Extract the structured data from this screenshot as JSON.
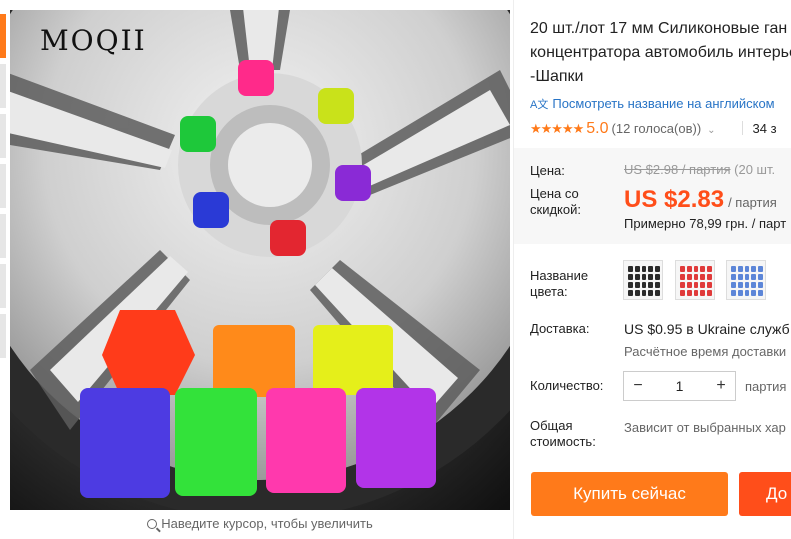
{
  "gallery": {
    "watermark": "MOQII",
    "zoom_hint": "Наведите курсор, чтобы увеличить"
  },
  "product": {
    "title": "20 шт./лот 17 мм Силиконовые ган гайка концентратора автомобиль интерьера -Шапки",
    "translate_link": "Посмотреть название на английском",
    "translate_icon": "translate-icon",
    "rating": {
      "stars": "★★★★★",
      "value": "5.0",
      "count": "(12 голоса(ов))",
      "orders": "34 з"
    }
  },
  "price": {
    "price_label": "Цена:",
    "original": "US $2.98 / партия",
    "original_suffix": "(20 шт.",
    "discount_label_line1": "Цена со",
    "discount_label_line2": "скидкой:",
    "sale": "US $2.83",
    "sale_unit": "/ партия",
    "approx": "Примерно 78,99 грн. / парт"
  },
  "options": {
    "color_label_line1": "Название",
    "color_label_line2": "цвета:",
    "swatches": [
      {
        "name": "black",
        "color": "#2b2b2b"
      },
      {
        "name": "red",
        "color": "#e03a3a"
      },
      {
        "name": "blue",
        "color": "#5d86d8"
      }
    ]
  },
  "shipping": {
    "label": "Доставка:",
    "value": "US $0.95 в Ukraine служб",
    "eta": "Расчётное время доставки"
  },
  "quantity": {
    "label": "Количество:",
    "value": "1",
    "minus": "−",
    "plus": "+",
    "unit": "партия"
  },
  "total": {
    "label_line1": "Общая",
    "label_line2": "стоимость:",
    "value": "Зависит от выбранных хар"
  },
  "actions": {
    "buy_now": "Купить сейчас",
    "add_to_cart": "До"
  },
  "colors": {
    "accent": "#ff7a1a",
    "price_red": "#ff4e1a",
    "link_blue": "#2874c6"
  }
}
